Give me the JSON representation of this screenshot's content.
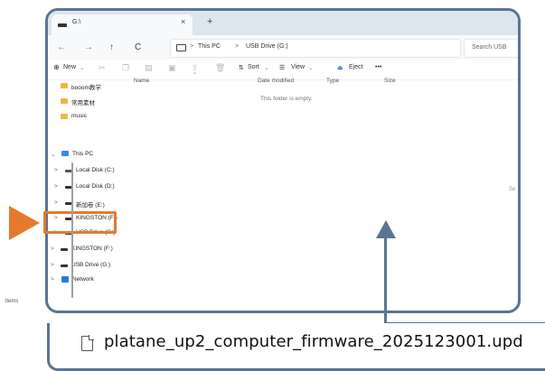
{
  "window": {
    "tab_title": "G:\\",
    "tab_close": "×",
    "tab_new": "+",
    "nav": {
      "back": "←",
      "forward": "→",
      "up": "↑",
      "refresh": "C"
    },
    "breadcrumb": [
      "This PC",
      "USB Drive (G:)"
    ],
    "breadcrumb_sep": ">",
    "search_placeholder": "Search USB"
  },
  "toolbar": {
    "new_label": "New",
    "sort_label": "Sort",
    "view_label": "View",
    "eject_label": "Eject",
    "more_label": "•••"
  },
  "sidebar": {
    "items": [
      {
        "label": "booom教学",
        "kind": "folder"
      },
      {
        "label": "常用素材",
        "kind": "folder"
      },
      {
        "label": "music",
        "kind": "folder"
      },
      {
        "label": "This PC",
        "kind": "pc"
      },
      {
        "label": "Local Disk (C:)",
        "kind": "drive"
      },
      {
        "label": "Local Disk (D:)",
        "kind": "drive"
      },
      {
        "label": "新加卷 (E:)",
        "kind": "drive"
      },
      {
        "label": "KINGSTON (F:)",
        "kind": "drive"
      },
      {
        "label": "USB Drive (G:)",
        "kind": "drive",
        "selected": true
      },
      {
        "label": "KINGSTON (F:)",
        "kind": "drive"
      },
      {
        "label": "USB Drive (G:)",
        "kind": "drive"
      },
      {
        "label": "Network",
        "kind": "network"
      }
    ]
  },
  "columns": [
    "Name",
    "Date modified",
    "Type",
    "Size"
  ],
  "empty_message": "This folder is empty.",
  "side_hint": "Se",
  "status": "items",
  "callout": {
    "filename": "platane_up2_computer_firmware_2025123001.upd"
  },
  "colors": {
    "frame": "#5a7592",
    "highlight": "#e57a2e",
    "selection": "#cce4f7"
  }
}
